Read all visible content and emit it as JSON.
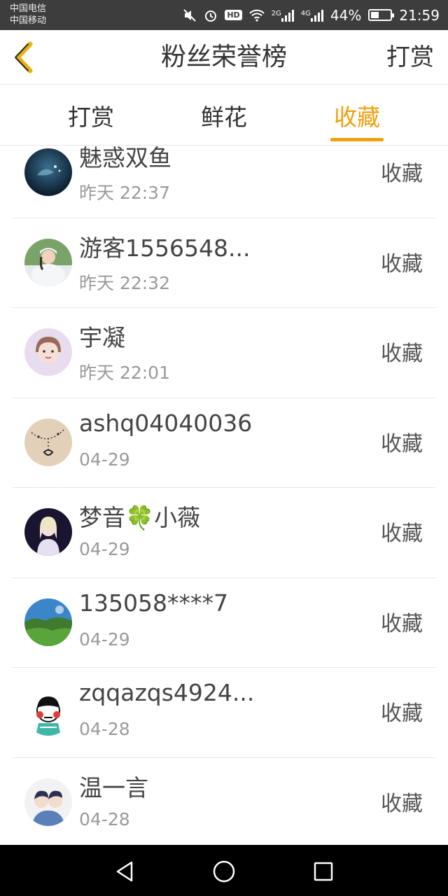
{
  "status_bar": {
    "carrier_1": "中国电信",
    "carrier_2": "中国移动",
    "hd": "HD",
    "net_1": "2G",
    "net_2": "4G",
    "battery": "44%",
    "battery_level": 0.44,
    "time": "21:59"
  },
  "header": {
    "title": "粉丝荣誉榜",
    "action": "打赏",
    "back_icon": "chevron-left-icon"
  },
  "tabs": [
    {
      "label": "打赏",
      "active": false
    },
    {
      "label": "鲜花",
      "active": false
    },
    {
      "label": "收藏",
      "active": true
    }
  ],
  "accent_color": "#f0a10e",
  "list": [
    {
      "name": "魅惑双鱼",
      "time": "昨天 22:37",
      "action": "收藏"
    },
    {
      "name": "游客1556548...",
      "time": "昨天 22:32",
      "action": "收藏"
    },
    {
      "name": "宇凝",
      "time": "昨天 22:01",
      "action": "收藏"
    },
    {
      "name": "ashq04040036",
      "time": "04-29",
      "action": "收藏"
    },
    {
      "name": "梦音🍀小薇",
      "time": "04-29",
      "action": "收藏"
    },
    {
      "name": "135058****7",
      "time": "04-29",
      "action": "收藏"
    },
    {
      "name": "zqqazqs4924...",
      "time": "04-28",
      "action": "收藏"
    },
    {
      "name": "温一言",
      "time": "04-28",
      "action": "收藏"
    }
  ],
  "nav_bar": {
    "back": "triangle-back-icon",
    "home": "circle-home-icon",
    "recents": "square-recents-icon"
  }
}
